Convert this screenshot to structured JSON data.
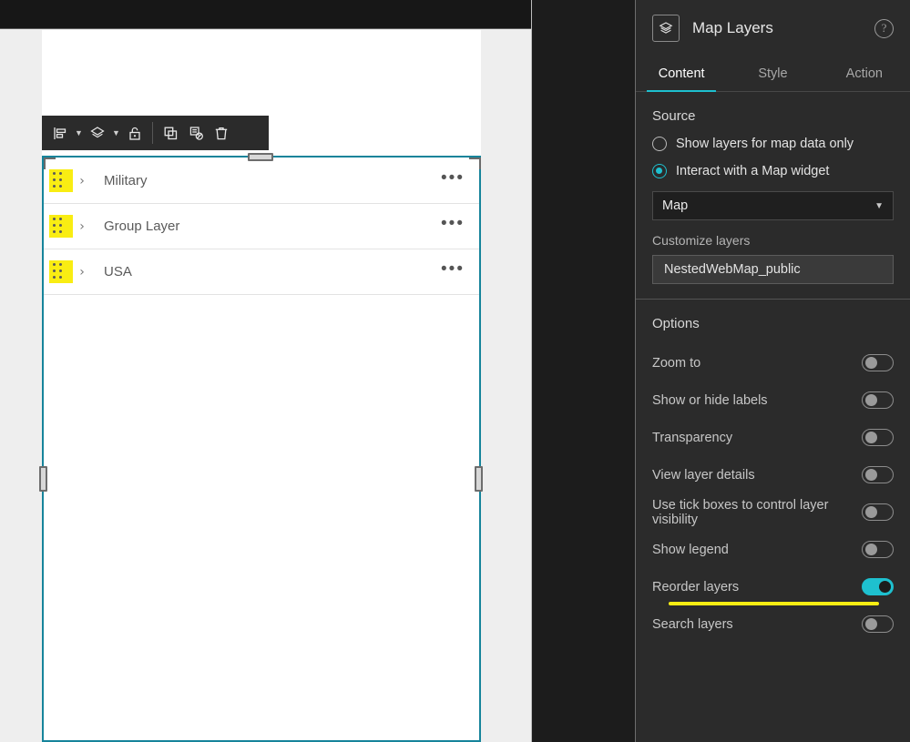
{
  "canvas": {
    "toolbar": {
      "items": [
        {
          "name": "align-icon",
          "has_caret": true
        },
        {
          "name": "order-layers-icon",
          "has_caret": true
        },
        {
          "name": "unlock-icon",
          "has_caret": false
        },
        {
          "name": "duplicate-icon",
          "has_caret": false
        },
        {
          "name": "disable-widget-icon",
          "has_caret": false
        },
        {
          "name": "delete-icon",
          "has_caret": false
        }
      ]
    },
    "layers": [
      {
        "label": "Military",
        "expand_glyph": "›",
        "menu_glyph": "•••"
      },
      {
        "label": "Group Layer",
        "expand_glyph": "›",
        "menu_glyph": "•••"
      },
      {
        "label": "USA",
        "expand_glyph": "›",
        "menu_glyph": "•••"
      }
    ]
  },
  "panel": {
    "title": "Map Layers",
    "help_glyph": "?",
    "tabs": [
      {
        "label": "Content",
        "active": true
      },
      {
        "label": "Style",
        "active": false
      },
      {
        "label": "Action",
        "active": false
      }
    ],
    "source": {
      "title": "Source",
      "options": [
        {
          "label": "Show layers for map data only",
          "selected": false
        },
        {
          "label": "Interact with a Map widget",
          "selected": true
        }
      ],
      "widget_select": {
        "value": "Map",
        "caret_glyph": "∨"
      },
      "customize_label": "Customize layers",
      "customize_value": "NestedWebMap_public"
    },
    "options": {
      "title": "Options",
      "rows": [
        {
          "label": "Zoom to",
          "on": false,
          "highlighted": false
        },
        {
          "label": "Show or hide labels",
          "on": false,
          "highlighted": false
        },
        {
          "label": "Transparency",
          "on": false,
          "highlighted": false
        },
        {
          "label": "View layer details",
          "on": false,
          "highlighted": false
        },
        {
          "label": "Use tick boxes to control layer visibility",
          "on": false,
          "highlighted": false
        },
        {
          "label": "Show legend",
          "on": false,
          "highlighted": false
        },
        {
          "label": "Reorder layers",
          "on": true,
          "highlighted": true
        },
        {
          "label": "Search layers",
          "on": false,
          "highlighted": false
        }
      ]
    }
  },
  "colors": {
    "accent": "#1ec0cf",
    "highlight": "#f9ed13",
    "panel_bg": "#2b2b2b",
    "selection_border": "#16849b"
  }
}
